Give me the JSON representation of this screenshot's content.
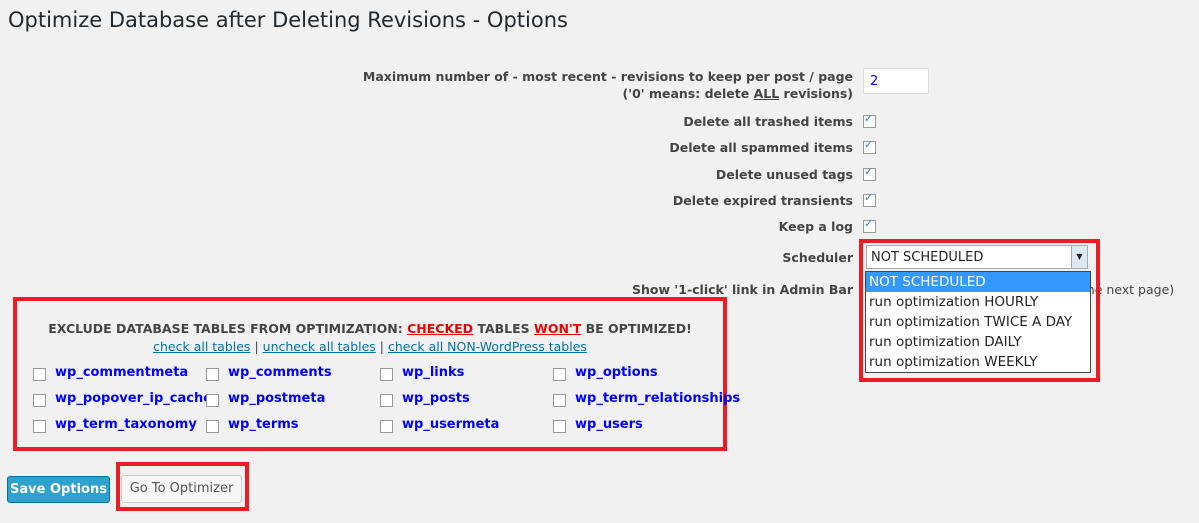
{
  "title": "Optimize Database after Deleting Revisions - Options",
  "options": {
    "max_revisions_label": "Maximum number of - most recent - revisions to keep per post / page",
    "max_revisions_note_pre": "('0' means: delete ",
    "max_revisions_note_all": "ALL",
    "max_revisions_note_post": " revisions)",
    "max_revisions_value": "2",
    "checkboxes": [
      {
        "label": "Delete all trashed items",
        "checked": true
      },
      {
        "label": "Delete all spammed items",
        "checked": true
      },
      {
        "label": "Delete unused tags",
        "checked": true
      },
      {
        "label": "Delete expired transients",
        "checked": true
      },
      {
        "label": "Keep a log",
        "checked": true
      }
    ],
    "scheduler_label": "Scheduler",
    "scheduler_value": "NOT SCHEDULED",
    "scheduler_options": [
      "NOT SCHEDULED",
      "run optimization HOURLY",
      "run optimization TWICE A DAY",
      "run optimization DAILY",
      "run optimization WEEKLY"
    ],
    "admin_bar_label": "Show '1-click' link in Admin Bar",
    "admin_bar_note_visible": "g the next page)"
  },
  "exclude": {
    "header_pre": "EXCLUDE DATABASE TABLES FROM OPTIMIZATION: ",
    "checked": "CHECKED",
    "header_mid": " TABLES ",
    "wont": "WON'T",
    "header_post": " BE OPTIMIZED!",
    "link_check_all": "check all tables",
    "link_uncheck_all": "uncheck all tables",
    "link_non_wp": "check all NON-WordPress tables",
    "separator": "|",
    "tables": [
      "wp_commentmeta",
      "wp_comments",
      "wp_links",
      "wp_options",
      "wp_popover_ip_cache",
      "wp_postmeta",
      "wp_posts",
      "wp_term_relationships",
      "wp_term_taxonomy",
      "wp_terms",
      "wp_usermeta",
      "wp_users"
    ]
  },
  "buttons": {
    "save": "Save Options",
    "optimizer": "Go To Optimizer"
  },
  "colors": {
    "highlight": "#ed1c24",
    "primary": "#2ea2cc",
    "link": "#0073aa",
    "table_link": "#0000ff"
  }
}
